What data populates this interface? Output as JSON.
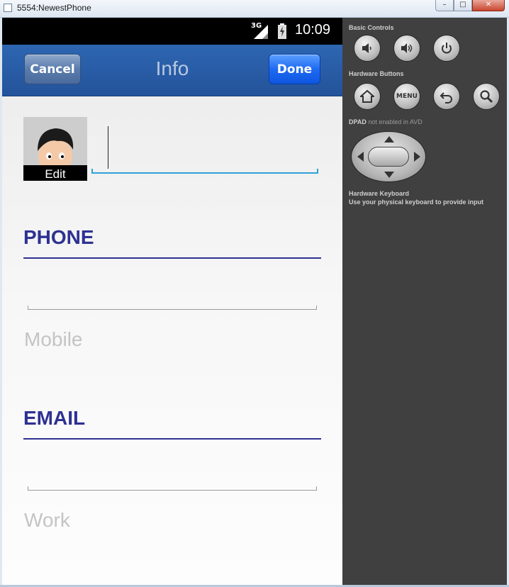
{
  "window": {
    "title": "5554:NewestPhone",
    "minimize_label": "–",
    "maximize_label": "□",
    "close_label": "✕"
  },
  "statusbar": {
    "network": "3G",
    "time": "10:09",
    "icons": [
      "signal-icon",
      "battery-charging-icon"
    ]
  },
  "navbar": {
    "cancel_label": "Cancel",
    "title": "Info",
    "done_label": "Done"
  },
  "contact": {
    "avatar_edit_label": "Edit",
    "name_value": ""
  },
  "sections": {
    "phone": {
      "heading": "PHONE",
      "field_value": "",
      "type_label": "Mobile"
    },
    "email": {
      "heading": "EMAIL",
      "field_value": "",
      "type_label": "Work"
    }
  },
  "panel": {
    "basic_controls_label": "Basic Controls",
    "basic_controls": [
      "volume-down-icon",
      "volume-up-icon",
      "power-icon"
    ],
    "hardware_buttons_label": "Hardware Buttons",
    "hardware_buttons": [
      "home-icon",
      "menu-button",
      "back-icon",
      "search-icon"
    ],
    "menu_label": "MENU",
    "dpad_label": "DPAD",
    "dpad_note": "not enabled in AVD",
    "keyboard_title": "Hardware Keyboard",
    "keyboard_note": "Use your physical keyboard to provide input"
  },
  "colors": {
    "navbar": "#2e66b2",
    "done_button": "#1f6af2",
    "section_heading": "#2e3192",
    "focus_underline": "#2ea2d8",
    "placeholder_text": "#c4c4c4",
    "panel_bg": "#404040"
  }
}
